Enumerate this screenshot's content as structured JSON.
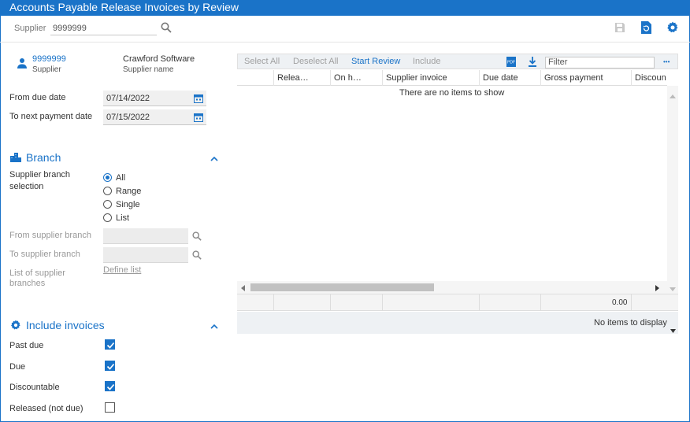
{
  "app": {
    "title": "Accounts Payable Release Invoices by Review"
  },
  "header": {
    "supplier_label": "Supplier",
    "supplier_value": "9999999",
    "icons": {
      "search": "search-icon",
      "save": "save-icon",
      "refresh": "refresh-icon",
      "settings": "gear-icon"
    }
  },
  "supplier_card": {
    "id": "9999999",
    "id_caption": "Supplier",
    "name": "Crawford Software",
    "name_caption": "Supplier name"
  },
  "dates": {
    "from_label": "From due date",
    "from_value": "07/14/2022",
    "to_label": "To next payment date",
    "to_value": "07/15/2022"
  },
  "branch": {
    "title": "Branch",
    "selection_label_line1": "Supplier branch",
    "selection_label_line2": "selection",
    "options": [
      "All",
      "Range",
      "Single",
      "List"
    ],
    "selected": "All",
    "from_label": "From supplier branch",
    "to_label": "To supplier branch",
    "list_label_line1": "List of supplier",
    "list_label_line2": "branches",
    "define_list": "Define list"
  },
  "include": {
    "title": "Include invoices",
    "items": [
      {
        "label": "Past due",
        "checked": true
      },
      {
        "label": "Due",
        "checked": true
      },
      {
        "label": "Discountable",
        "checked": true
      },
      {
        "label": "Released (not due)",
        "checked": false
      }
    ]
  },
  "grid": {
    "toolbar": {
      "select_all": "Select All",
      "deselect_all": "Deselect All",
      "start_review": "Start Review",
      "include": "Include",
      "filter_placeholder": "Filter",
      "more": "•••"
    },
    "columns": [
      "Relea…",
      "On h…",
      "Supplier invoice",
      "Due date",
      "Gross payment",
      "Discoun"
    ],
    "empty_message": "There are no items to show",
    "footer_total": "0.00",
    "status": "No items to display"
  },
  "colors": {
    "accent": "#1a73c8",
    "disabled": "#a0a0a0"
  }
}
